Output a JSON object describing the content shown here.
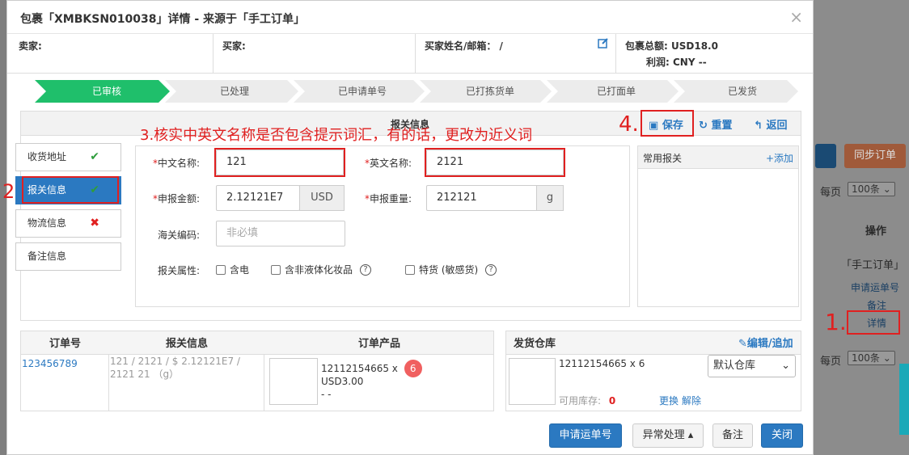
{
  "background": {
    "sync_order_label": "同步订单",
    "per_page_label": "每页",
    "per_page_value": "100条",
    "ops_header": "操作",
    "source_tag": "「手工订单」",
    "apply_tracking_link": "申请运单号",
    "note_link": "备注",
    "detail_link": "详情",
    "per_page_label_2": "每页",
    "per_page_value_2": "100条"
  },
  "modal": {
    "title": "包裹「XMBKSN010038」详情 - 来源于「手工订单」",
    "close": "×",
    "seller_label": "卖家:",
    "buyer_label": "买家:",
    "buyer_name_email": "买家姓名/邮箱： /",
    "package_total_label": "包裹总额:",
    "package_total_value": "USD18.0",
    "profit_label": "利润:",
    "profit_value": "CNY --"
  },
  "steps": [
    "已审核",
    "已处理",
    "已申请单号",
    "已打拣货单",
    "已打面单",
    "已发货"
  ],
  "customs": {
    "panel_title": "报关信息",
    "save_label": "保存",
    "reset_label": "重置",
    "back_label": "返回",
    "side_tabs": [
      {
        "label": "收货地址",
        "mark": "✔",
        "mark_color": "#2e9d3c"
      },
      {
        "label": "报关信息",
        "mark": "✔",
        "mark_color": "#2e9d3c"
      },
      {
        "label": "物流信息",
        "mark": "✖",
        "mark_color": "#e02020"
      },
      {
        "label": "备注信息",
        "mark": "",
        "mark_color": ""
      }
    ],
    "cn_name_label": "中文名称:",
    "cn_name_value": "121",
    "en_name_label": "英文名称:",
    "en_name_value": "2121",
    "amount_label": "申报金额:",
    "amount_value": "2.12121E7",
    "amount_currency": "USD",
    "weight_label": "申报重量:",
    "weight_value": "212121",
    "weight_unit": "g",
    "hs_code_label": "海关编码:",
    "hs_code_placeholder": "非必填",
    "attr_label": "报关属性:",
    "attr_battery": "含电",
    "attr_cosmetic": "含非液体化妆品",
    "attr_sensitive": "特货 (敏感货)",
    "common_customs_label": "常用报关",
    "add_label": "+添加"
  },
  "annotations": {
    "step1": "1.",
    "step2": "2",
    "step3": "3.核实中英文名称是否包含提示词汇，有的话，更改为近义词",
    "step4": "4."
  },
  "order_table": {
    "headers": [
      "订单号",
      "报关信息",
      "订单产品"
    ],
    "order_no": "123456789",
    "customs_summary": "121 / 2121 / $ 2.12121E7 / 2121 21 （g）",
    "product_sku": "12112154665 x",
    "product_qty": "6",
    "product_price": "USD3.00",
    "product_extra": "- -"
  },
  "warehouse": {
    "header": "发货仓库",
    "edit_label": "编辑/追加",
    "sku_line": "12112154665 x 6",
    "stock_label": "可用库存:",
    "stock_value": "0",
    "replace_label": "更换",
    "remove_label": "解除",
    "select_value": "默认仓库"
  },
  "footer": {
    "apply_tracking": "申请运单号",
    "exception": "异常处理 ▴",
    "note": "备注",
    "close": "关闭"
  },
  "colors": {
    "step_active": "#1fbf6b",
    "primary": "#2b79c1",
    "annotation": "#e02020"
  }
}
